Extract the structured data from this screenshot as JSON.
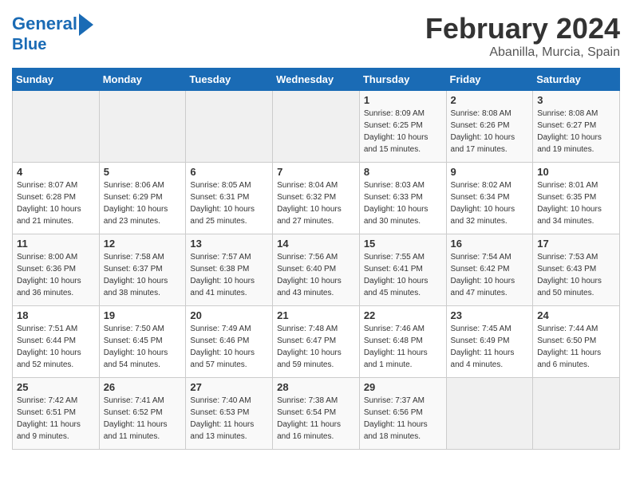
{
  "header": {
    "logo_line1": "General",
    "logo_line2": "Blue",
    "month": "February 2024",
    "location": "Abanilla, Murcia, Spain"
  },
  "days_of_week": [
    "Sunday",
    "Monday",
    "Tuesday",
    "Wednesday",
    "Thursday",
    "Friday",
    "Saturday"
  ],
  "weeks": [
    [
      {
        "day": "",
        "info": ""
      },
      {
        "day": "",
        "info": ""
      },
      {
        "day": "",
        "info": ""
      },
      {
        "day": "",
        "info": ""
      },
      {
        "day": "1",
        "info": "Sunrise: 8:09 AM\nSunset: 6:25 PM\nDaylight: 10 hours\nand 15 minutes."
      },
      {
        "day": "2",
        "info": "Sunrise: 8:08 AM\nSunset: 6:26 PM\nDaylight: 10 hours\nand 17 minutes."
      },
      {
        "day": "3",
        "info": "Sunrise: 8:08 AM\nSunset: 6:27 PM\nDaylight: 10 hours\nand 19 minutes."
      }
    ],
    [
      {
        "day": "4",
        "info": "Sunrise: 8:07 AM\nSunset: 6:28 PM\nDaylight: 10 hours\nand 21 minutes."
      },
      {
        "day": "5",
        "info": "Sunrise: 8:06 AM\nSunset: 6:29 PM\nDaylight: 10 hours\nand 23 minutes."
      },
      {
        "day": "6",
        "info": "Sunrise: 8:05 AM\nSunset: 6:31 PM\nDaylight: 10 hours\nand 25 minutes."
      },
      {
        "day": "7",
        "info": "Sunrise: 8:04 AM\nSunset: 6:32 PM\nDaylight: 10 hours\nand 27 minutes."
      },
      {
        "day": "8",
        "info": "Sunrise: 8:03 AM\nSunset: 6:33 PM\nDaylight: 10 hours\nand 30 minutes."
      },
      {
        "day": "9",
        "info": "Sunrise: 8:02 AM\nSunset: 6:34 PM\nDaylight: 10 hours\nand 32 minutes."
      },
      {
        "day": "10",
        "info": "Sunrise: 8:01 AM\nSunset: 6:35 PM\nDaylight: 10 hours\nand 34 minutes."
      }
    ],
    [
      {
        "day": "11",
        "info": "Sunrise: 8:00 AM\nSunset: 6:36 PM\nDaylight: 10 hours\nand 36 minutes."
      },
      {
        "day": "12",
        "info": "Sunrise: 7:58 AM\nSunset: 6:37 PM\nDaylight: 10 hours\nand 38 minutes."
      },
      {
        "day": "13",
        "info": "Sunrise: 7:57 AM\nSunset: 6:38 PM\nDaylight: 10 hours\nand 41 minutes."
      },
      {
        "day": "14",
        "info": "Sunrise: 7:56 AM\nSunset: 6:40 PM\nDaylight: 10 hours\nand 43 minutes."
      },
      {
        "day": "15",
        "info": "Sunrise: 7:55 AM\nSunset: 6:41 PM\nDaylight: 10 hours\nand 45 minutes."
      },
      {
        "day": "16",
        "info": "Sunrise: 7:54 AM\nSunset: 6:42 PM\nDaylight: 10 hours\nand 47 minutes."
      },
      {
        "day": "17",
        "info": "Sunrise: 7:53 AM\nSunset: 6:43 PM\nDaylight: 10 hours\nand 50 minutes."
      }
    ],
    [
      {
        "day": "18",
        "info": "Sunrise: 7:51 AM\nSunset: 6:44 PM\nDaylight: 10 hours\nand 52 minutes."
      },
      {
        "day": "19",
        "info": "Sunrise: 7:50 AM\nSunset: 6:45 PM\nDaylight: 10 hours\nand 54 minutes."
      },
      {
        "day": "20",
        "info": "Sunrise: 7:49 AM\nSunset: 6:46 PM\nDaylight: 10 hours\nand 57 minutes."
      },
      {
        "day": "21",
        "info": "Sunrise: 7:48 AM\nSunset: 6:47 PM\nDaylight: 10 hours\nand 59 minutes."
      },
      {
        "day": "22",
        "info": "Sunrise: 7:46 AM\nSunset: 6:48 PM\nDaylight: 11 hours\nand 1 minute."
      },
      {
        "day": "23",
        "info": "Sunrise: 7:45 AM\nSunset: 6:49 PM\nDaylight: 11 hours\nand 4 minutes."
      },
      {
        "day": "24",
        "info": "Sunrise: 7:44 AM\nSunset: 6:50 PM\nDaylight: 11 hours\nand 6 minutes."
      }
    ],
    [
      {
        "day": "25",
        "info": "Sunrise: 7:42 AM\nSunset: 6:51 PM\nDaylight: 11 hours\nand 9 minutes."
      },
      {
        "day": "26",
        "info": "Sunrise: 7:41 AM\nSunset: 6:52 PM\nDaylight: 11 hours\nand 11 minutes."
      },
      {
        "day": "27",
        "info": "Sunrise: 7:40 AM\nSunset: 6:53 PM\nDaylight: 11 hours\nand 13 minutes."
      },
      {
        "day": "28",
        "info": "Sunrise: 7:38 AM\nSunset: 6:54 PM\nDaylight: 11 hours\nand 16 minutes."
      },
      {
        "day": "29",
        "info": "Sunrise: 7:37 AM\nSunset: 6:56 PM\nDaylight: 11 hours\nand 18 minutes."
      },
      {
        "day": "",
        "info": ""
      },
      {
        "day": "",
        "info": ""
      }
    ]
  ]
}
